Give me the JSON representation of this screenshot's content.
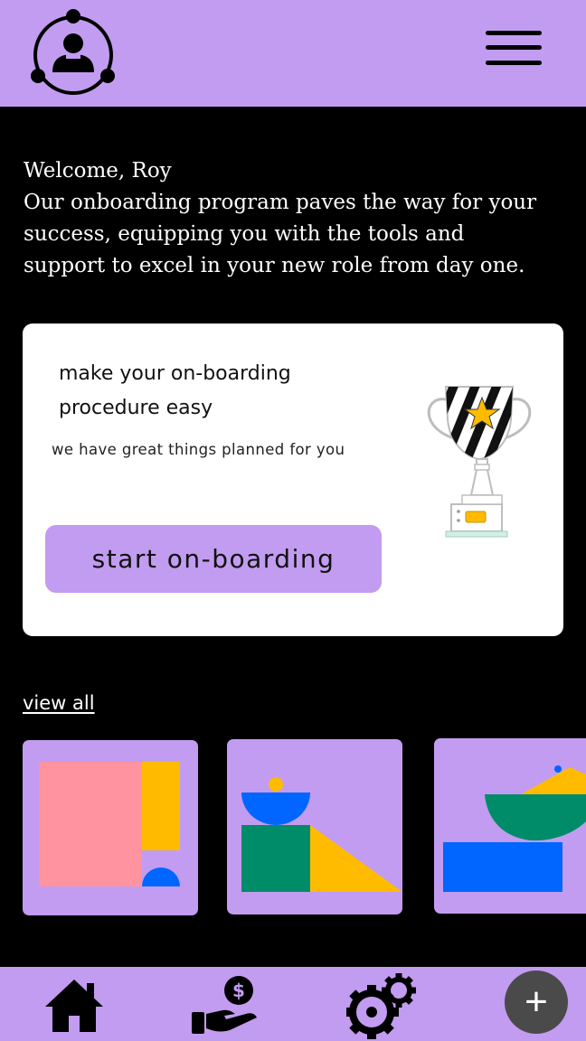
{
  "header": {
    "logo_icon": "user-network-icon",
    "menu_icon": "hamburger-icon"
  },
  "welcome": {
    "greeting": "Welcome, Roy",
    "message": "Our onboarding program paves the way for your success, equipping you with the tools and support to excel in your new role from day one."
  },
  "card": {
    "title": "make your on-boarding procedure easy",
    "subtitle": "we have great things planned for you",
    "button_label": "start on-boarding",
    "illustration_icon": "trophy-icon"
  },
  "view_all": "view all",
  "tiles": [
    {
      "icon": "abstract-shapes-1-icon"
    },
    {
      "icon": "abstract-shapes-2-icon"
    },
    {
      "icon": "abstract-shapes-3-icon"
    }
  ],
  "nav": {
    "home_icon": "home-icon",
    "pay_icon": "money-hand-icon",
    "settings_icon": "gears-icon",
    "add_icon": "plus-icon",
    "add_symbol": "+"
  },
  "colors": {
    "accent": "#c29cf0",
    "background": "#000000",
    "card": "#ffffff",
    "pink": "#ff939f",
    "yellow": "#ffbb00",
    "blue": "#0066ff",
    "green": "#008c69"
  }
}
